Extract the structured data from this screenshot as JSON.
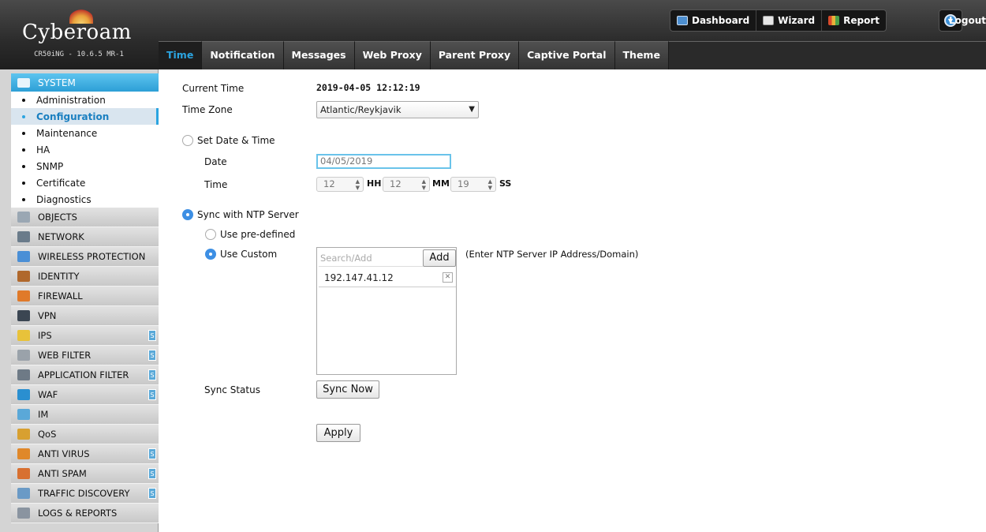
{
  "brand": {
    "name": "Cyberoam",
    "model": "CR50iNG - 10.6.5 MR-1"
  },
  "topnav": {
    "dashboard": "Dashboard",
    "wizard": "Wizard",
    "report": "Report",
    "logout": "Logout"
  },
  "tabs": [
    {
      "label": "Time",
      "active": true
    },
    {
      "label": "Notification"
    },
    {
      "label": "Messages"
    },
    {
      "label": "Web Proxy"
    },
    {
      "label": "Parent Proxy"
    },
    {
      "label": "Captive Portal"
    },
    {
      "label": "Theme"
    }
  ],
  "sidebar": {
    "system_label": "SYSTEM",
    "sub": [
      "Administration",
      "Configuration",
      "Maintenance",
      "HA",
      "SNMP",
      "Certificate",
      "Diagnostics"
    ],
    "active_sub": "Configuration",
    "modules": [
      {
        "label": "OBJECTS",
        "icon": "objects-icon",
        "color": "#9aa7b3",
        "s": false
      },
      {
        "label": "NETWORK",
        "icon": "network-icon",
        "color": "#6a7b8a",
        "s": false
      },
      {
        "label": "WIRELESS PROTECTION",
        "icon": "wireless-icon",
        "color": "#4a8fd6",
        "s": false
      },
      {
        "label": "IDENTITY",
        "icon": "identity-icon",
        "color": "#b0682c",
        "s": false
      },
      {
        "label": "FIREWALL",
        "icon": "firewall-icon",
        "color": "#e07a2a",
        "s": false
      },
      {
        "label": "VPN",
        "icon": "vpn-icon",
        "color": "#3b4652",
        "s": false
      },
      {
        "label": "IPS",
        "icon": "ips-icon",
        "color": "#e8c23a",
        "s": true
      },
      {
        "label": "WEB FILTER",
        "icon": "web-filter-icon",
        "color": "#9aa2aa",
        "s": true
      },
      {
        "label": "APPLICATION FILTER",
        "icon": "application-filter-icon",
        "color": "#6e7a86",
        "s": true
      },
      {
        "label": "WAF",
        "icon": "waf-icon",
        "color": "#2a8fd0",
        "s": true
      },
      {
        "label": "IM",
        "icon": "im-icon",
        "color": "#5aa8d8",
        "s": false
      },
      {
        "label": "QoS",
        "icon": "qos-icon",
        "color": "#d8a030",
        "s": false
      },
      {
        "label": "ANTI VIRUS",
        "icon": "anti-virus-icon",
        "color": "#e0882a",
        "s": true
      },
      {
        "label": "ANTI SPAM",
        "icon": "anti-spam-icon",
        "color": "#d87030",
        "s": true
      },
      {
        "label": "TRAFFIC DISCOVERY",
        "icon": "traffic-discovery-icon",
        "color": "#6a9ac6",
        "s": true
      },
      {
        "label": "LOGS & REPORTS",
        "icon": "logs-reports-icon",
        "color": "#8a94a0",
        "s": false
      }
    ]
  },
  "form": {
    "current_time_label": "Current Time",
    "current_time_value": "2019-04-05 12:12:19",
    "timezone_label": "Time Zone",
    "timezone_value": "Atlantic/Reykjavik",
    "set_datetime_label": "Set Date & Time",
    "date_label": "Date",
    "date_value": "04/05/2019",
    "time_label": "Time",
    "hh_value": "12",
    "hh_unit": "HH",
    "mm_value": "12",
    "mm_unit": "MM",
    "ss_value": "19",
    "ss_unit": "SS",
    "sync_ntp_label": "Sync with NTP Server",
    "use_predefined_label": "Use pre-defined",
    "use_custom_label": "Use Custom",
    "search_placeholder": "Search/Add",
    "add_button": "Add",
    "ntp_hint": "(Enter NTP Server IP Address/Domain)",
    "ntp_entries": [
      "192.147.41.12"
    ],
    "sync_status_label": "Sync Status",
    "sync_now_button": "Sync Now",
    "apply_button": "Apply"
  }
}
